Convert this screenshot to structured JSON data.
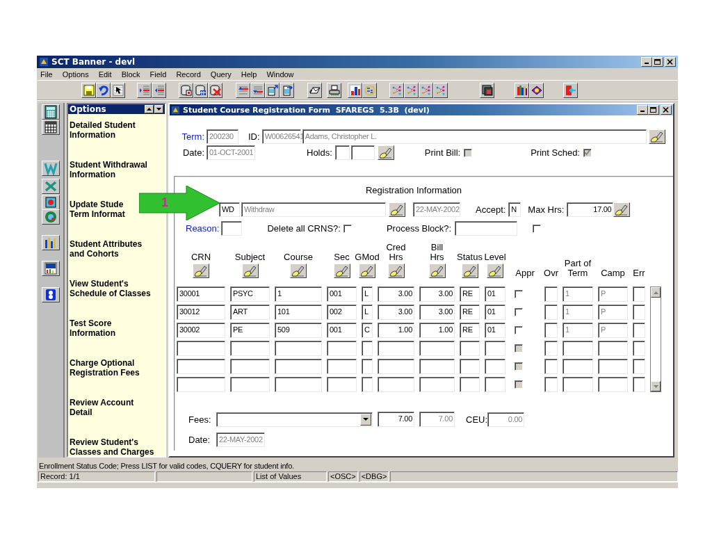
{
  "window": {
    "title": "SCT Banner - devl"
  },
  "menu": [
    "File",
    "Options",
    "Edit",
    "Block",
    "Field",
    "Record",
    "Query",
    "Help",
    "Window"
  ],
  "options_panel": {
    "title": "Options",
    "items": [
      {
        "lines": [
          "Detailed Student",
          "Information"
        ]
      },
      {
        "lines": [
          "Student Withdrawal",
          "Information"
        ]
      },
      {
        "lines": [
          "Update Stude",
          "Term Informat"
        ]
      },
      {
        "lines": [
          "Student Attributes",
          "and Cohorts"
        ]
      },
      {
        "lines": [
          "View Student's",
          "Schedule of Classes"
        ]
      },
      {
        "lines": [
          "Test Score",
          "Information"
        ]
      },
      {
        "lines": [
          "Charge Optional",
          "Registration Fees"
        ]
      },
      {
        "lines": [
          "Review Account",
          "Detail"
        ]
      },
      {
        "lines": [
          "Review Student's",
          "Classes and Charges"
        ]
      }
    ]
  },
  "form": {
    "title": "Student Course Registration Form  SFAREGS  5.3B  (devl)",
    "term": {
      "label": "Term:",
      "value": "200230"
    },
    "id": {
      "label": "ID:",
      "value": "W00626541",
      "name": "Adams, Christopher L."
    },
    "date": {
      "label": "Date:",
      "value": "01-OCT-2001"
    },
    "holds": {
      "label": "Holds:"
    },
    "print_bill": {
      "label": "Print Bill:",
      "checked": false,
      "disabled": true
    },
    "print_sched": {
      "label": "Print Sched:",
      "checked": true,
      "disabled": true
    },
    "registration": {
      "title": "Registration Information",
      "status_code": "WD",
      "status_desc": "Withdraw",
      "status_date": "22-MAY-2002",
      "accept": {
        "label": "Accept:",
        "value": "N"
      },
      "max_hrs": {
        "label": "Max Hrs:",
        "value": "17.00"
      },
      "reason": {
        "label": "Reason:"
      },
      "delete_all": {
        "label": "Delete all CRNS?:",
        "checked": false,
        "disabled": false
      },
      "process_block": {
        "label": "Process Block?:",
        "checked": false,
        "disabled": false
      },
      "columns": [
        {
          "lines": [
            "CRN"
          ],
          "lookup": true
        },
        {
          "lines": [
            "Subject"
          ],
          "lookup": true
        },
        {
          "lines": [
            "Course"
          ],
          "lookup": true
        },
        {
          "lines": [
            "Sec"
          ],
          "lookup": true
        },
        {
          "lines": [
            "GMod"
          ],
          "lookup": true
        },
        {
          "lines": [
            "Cred",
            "Hrs"
          ],
          "lookup": true
        },
        {
          "lines": [
            "Bill",
            "Hrs"
          ],
          "lookup": true
        },
        {
          "lines": [
            "Status"
          ],
          "lookup": true
        },
        {
          "lines": [
            "Level"
          ],
          "lookup": true
        },
        {
          "lines": [
            "Appr"
          ],
          "lookup": false
        },
        {
          "lines": [
            "Ovr"
          ],
          "lookup": false
        },
        {
          "lines": [
            "Part of",
            "Term"
          ],
          "lookup": false
        },
        {
          "lines": [
            "Camp"
          ],
          "lookup": false
        },
        {
          "lines": [
            "Err"
          ],
          "lookup": false
        }
      ],
      "rows": [
        {
          "crn": "30001",
          "subject": "PSYC",
          "course": "1",
          "sec": "001",
          "gmod": "L",
          "cred_hrs": "3.00",
          "bill_hrs": "3.00",
          "status": "RE",
          "level": "01",
          "appr": {
            "checked": false,
            "disabled": false
          },
          "part_of_term": "1",
          "camp": "P"
        },
        {
          "crn": "30012",
          "subject": "ART",
          "course": "101",
          "sec": "002",
          "gmod": "L",
          "cred_hrs": "3.00",
          "bill_hrs": "3.00",
          "status": "RE",
          "level": "01",
          "appr": {
            "checked": false,
            "disabled": false
          },
          "part_of_term": "1",
          "camp": "P"
        },
        {
          "crn": "30002",
          "subject": "PE",
          "course": "509",
          "sec": "001",
          "gmod": "C",
          "cred_hrs": "1.00",
          "bill_hrs": "1.00",
          "status": "RE",
          "level": "01",
          "appr": {
            "checked": false,
            "disabled": false
          },
          "part_of_term": "1",
          "camp": "P"
        },
        {
          "appr": {
            "checked": false,
            "disabled": true
          }
        },
        {
          "appr": {
            "checked": false,
            "disabled": true
          }
        },
        {
          "appr": {
            "checked": false,
            "disabled": true
          }
        }
      ],
      "fees": {
        "label": "Fees:",
        "cred_total": "7.00",
        "bill_total": "7.00",
        "ceu_label": "CEU:",
        "ceu": "0.00"
      },
      "date": {
        "label": "Date:",
        "value": "22-MAY-2002"
      }
    }
  },
  "status_line": "Enrollment Status Code; Press LIST for valid codes, CQUERY for student info.",
  "status_bar": {
    "record": "Record: 1/1",
    "list": "List of Values",
    "osc": "<OSC>",
    "dbg": "<DBG>"
  },
  "callout": {
    "label": "1"
  }
}
